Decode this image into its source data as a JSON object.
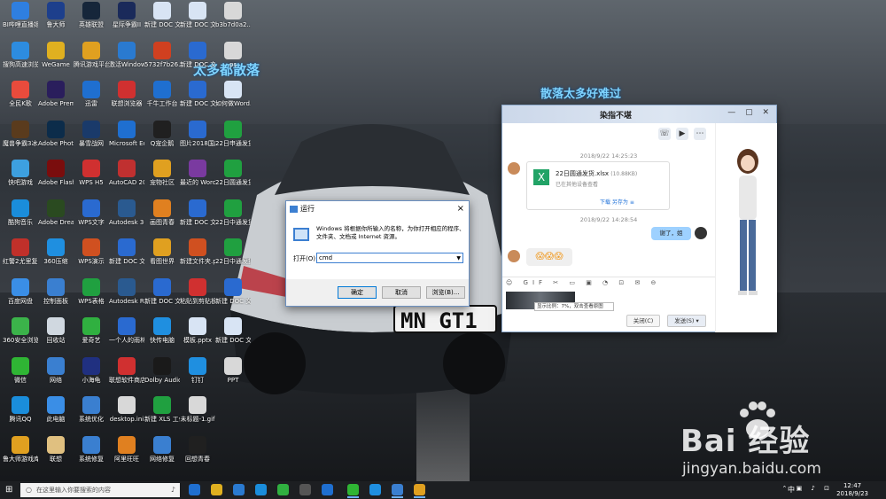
{
  "wallpaper": {
    "overlay_text_1": "太多都散落",
    "overlay_text_2": "散落太多好难过",
    "plate": "MN GT1"
  },
  "desktop_icons": [
    {
      "label": "BI哔哩直播姬",
      "color": "#2f7fe0"
    },
    {
      "label": "搜狗高速浏览器",
      "color": "#2d8ce0"
    },
    {
      "label": "全民K歌",
      "color": "#e94b3c"
    },
    {
      "label": "魔兽争霸3冰封王座",
      "color": "#5a3b1d"
    },
    {
      "label": "快吧游戏",
      "color": "#3da0e0"
    },
    {
      "label": "酷狗音乐",
      "color": "#1a8ddb"
    },
    {
      "label": "红警2尤里复仇",
      "color": "#c0302a"
    },
    {
      "label": "百度网盘",
      "color": "#3a8ee6"
    },
    {
      "label": "360安全浏览器",
      "color": "#3bb34a"
    },
    {
      "label": "微信",
      "color": "#2fb534"
    },
    {
      "label": "腾讯QQ",
      "color": "#1a8ddb"
    },
    {
      "label": "鲁大师游戏库",
      "color": "#e0a020"
    },
    {
      "label": "鲁大师",
      "color": "#1d3f8c"
    },
    {
      "label": "WeGame",
      "color": "#e0b020"
    },
    {
      "label": "Adobe Premi...",
      "color": "#2a1e5c"
    },
    {
      "label": "Adobe Photosh...",
      "color": "#0c2c4a"
    },
    {
      "label": "Adobe Flash Profession...",
      "color": "#7a0d0d"
    },
    {
      "label": "Adobe Dreamwe...",
      "color": "#2a4a20"
    },
    {
      "label": "360压缩",
      "color": "#1f8fe0"
    },
    {
      "label": "控制面板",
      "color": "#3a7fd0"
    },
    {
      "label": "回收站",
      "color": "#d0d8e0"
    },
    {
      "label": "网络",
      "color": "#3a7fd0"
    },
    {
      "label": "此电脑",
      "color": "#3a8ee6"
    },
    {
      "label": "联想",
      "color": "#e0c080"
    },
    {
      "label": "英雄联盟",
      "color": "#16263a"
    },
    {
      "label": "腾讯游戏平台",
      "color": "#e0a020"
    },
    {
      "label": "迅雷",
      "color": "#1f6fd0"
    },
    {
      "label": "暴雪战网",
      "color": "#1a3a6a"
    },
    {
      "label": "WPS H5",
      "color": "#d03030"
    },
    {
      "label": "WPS文字",
      "color": "#2a6ad0"
    },
    {
      "label": "WPS演示",
      "color": "#d05020"
    },
    {
      "label": "WPS表格",
      "color": "#20a040"
    },
    {
      "label": "爱奇艺",
      "color": "#30b040"
    },
    {
      "label": "小海龟",
      "color": "#203080"
    },
    {
      "label": "系统优化",
      "color": "#3a7fd0"
    },
    {
      "label": "系统修复",
      "color": "#3a7fd0"
    },
    {
      "label": "星际争霸II",
      "color": "#1a2a5a"
    },
    {
      "label": "激活Windows...",
      "color": "#2a7ad0"
    },
    {
      "label": "联想浏览器",
      "color": "#d03030"
    },
    {
      "label": "Microsoft Edge",
      "color": "#1f6fd0"
    },
    {
      "label": "AutoCAD 2014 - 简...",
      "color": "#c03030"
    },
    {
      "label": "Autodesk 360",
      "color": "#2a5a90"
    },
    {
      "label": "新建 DOC 文档.doc",
      "color": "#2a6ad0"
    },
    {
      "label": "Autodesk ReCap",
      "color": "#2a5a90"
    },
    {
      "label": "一个人的雨林.docx",
      "color": "#2a6ad0"
    },
    {
      "label": "联想软件商店",
      "color": "#d03030"
    },
    {
      "label": "desktop.ini",
      "color": "#d8d8d8"
    },
    {
      "label": "阿里旺旺",
      "color": "#e08020"
    },
    {
      "label": "新建 DOC 文档.doc",
      "color": "#d8e4f4"
    },
    {
      "label": "5732f7b26...",
      "color": "#d04020"
    },
    {
      "label": "千牛工作台",
      "color": "#1f6fd0"
    },
    {
      "label": "Q宠企鹅",
      "color": "#202020"
    },
    {
      "label": "宠物社区",
      "color": "#e0a020"
    },
    {
      "label": "画图青春",
      "color": "#e08020"
    },
    {
      "label": "看图世界",
      "color": "#e0a020"
    },
    {
      "label": "新建 DOC 文档.doc",
      "color": "#2a6ad0"
    },
    {
      "label": "快传电脑",
      "color": "#1f8fe0"
    },
    {
      "label": "Dolby Audio",
      "color": "#1a1a1a"
    },
    {
      "label": "新建 XLS 工作表.xls",
      "color": "#20a040"
    },
    {
      "label": "网络修复",
      "color": "#3a7fd0"
    },
    {
      "label": "新建 DOC 文档 (2).doc",
      "color": "#d8e4f4"
    },
    {
      "label": "新建 DOC 文档 (4).doc",
      "color": "#2a6ad0"
    },
    {
      "label": "新建 DOC 文档 (3).doc",
      "color": "#2a6ad0"
    },
    {
      "label": "图片2018国庆节.docx",
      "color": "#2a6ad0"
    },
    {
      "label": "最近的 Word",
      "color": "#7a3aa0"
    },
    {
      "label": "新建 DOC 文档 (6).doc",
      "color": "#2a6ad0"
    },
    {
      "label": "新建文件夹.ppt",
      "color": "#d05020"
    },
    {
      "label": "粘贴到剪贴板.pdf",
      "color": "#d03030"
    },
    {
      "label": "模板.pptx",
      "color": "#d8e4f4"
    },
    {
      "label": "钉钉",
      "color": "#1f8fe0"
    },
    {
      "label": "未标题-1.gif",
      "color": "#d8d8d8"
    },
    {
      "label": "回想青春",
      "color": "#202020"
    },
    {
      "label": "b3b7d0a2...",
      "color": "#d8d8d8"
    },
    {
      "label": "ps",
      "color": "#d8d8d8"
    },
    {
      "label": "如何做Word...",
      "color": "#d8e4f4"
    },
    {
      "label": "22日申通发货.xlsx",
      "color": "#20a040"
    },
    {
      "label": "22日圆通发货.xlsx",
      "color": "#20a040"
    },
    {
      "label": "22日中通发货.xlsx",
      "color": "#20a040"
    },
    {
      "label": "22日中通发货(2).xlsx",
      "color": "#20a040"
    },
    {
      "label": "新建 DOC 文档 (5).doc",
      "color": "#2a6ad0"
    },
    {
      "label": "新建 DOC 文档 (8).doc",
      "color": "#d8e4f4"
    },
    {
      "label": "PPT",
      "color": "#d8d8d8"
    }
  ],
  "run_dialog": {
    "title": "运行",
    "close": "×",
    "description": "Windows 将根据你所输入的名称，为你打开相应的程序、文件夹、文档或 Internet 资源。",
    "open_label": "打开(O):",
    "input_value": "cmd",
    "ok": "确定",
    "cancel": "取消",
    "browse": "浏览(B)..."
  },
  "qq_chat": {
    "title": "染指不堪",
    "window_controls": "— ▢ ✕",
    "timestamp1": "2018/9/22 14:25:23",
    "file_name": "22日圆通发货.xlsx",
    "file_size": "(10.88KB)",
    "file_status": "已在其他设备查看",
    "file_actions": "下载   另存为   ≡",
    "timestamp2": "2018/9/22 14:28:54",
    "my_message": "谢了，姐",
    "their_message": "😱😱😱",
    "input_toolbar": "☺ GIF ✂ ▭ ▣ ◔ ⊡ ✉ ⊖",
    "image_tip": "显示比例：7%，双击查看原图",
    "close_btn": "关闭(C)",
    "send_btn": "发送(S)  ▾"
  },
  "taskbar": {
    "search_placeholder": "在这里输入你要搜索的内容",
    "ime": "中",
    "tray": "⌃ ▣ ♪ ⊡",
    "time": "12:47",
    "date": "2018/9/23"
  },
  "watermark": {
    "brand": "Bai  经验",
    "url": "jingyan.baidu.com"
  }
}
